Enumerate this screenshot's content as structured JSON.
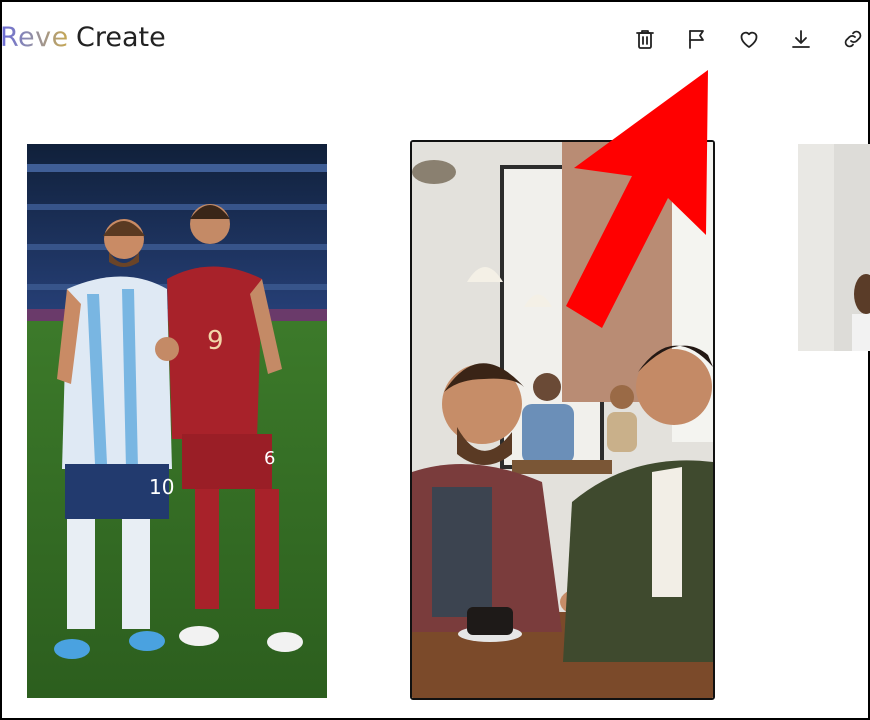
{
  "app": {
    "brand": "Reve",
    "page_title": "Create"
  },
  "toolbar": {
    "items": [
      {
        "name": "delete",
        "icon": "trash-icon"
      },
      {
        "name": "report",
        "icon": "flag-icon"
      },
      {
        "name": "favorite",
        "icon": "heart-icon"
      },
      {
        "name": "download",
        "icon": "download-icon"
      },
      {
        "name": "copy-link",
        "icon": "link-icon"
      }
    ]
  },
  "gallery": {
    "images": [
      {
        "subject": "two soccer players posing on a stadium pitch",
        "jersey_left": "10",
        "jersey_right": "9",
        "jersey_right_shorts": "6"
      },
      {
        "subject": "two men chatting over coffee in a cafe",
        "selected": true
      },
      {
        "subject": "partially visible image"
      }
    ]
  },
  "annotation": {
    "arrow_color": "#ff0000",
    "points_to": "report"
  },
  "colors": {
    "arrow": "#ff0000",
    "text": "#222222",
    "selection_border": "#111111"
  }
}
